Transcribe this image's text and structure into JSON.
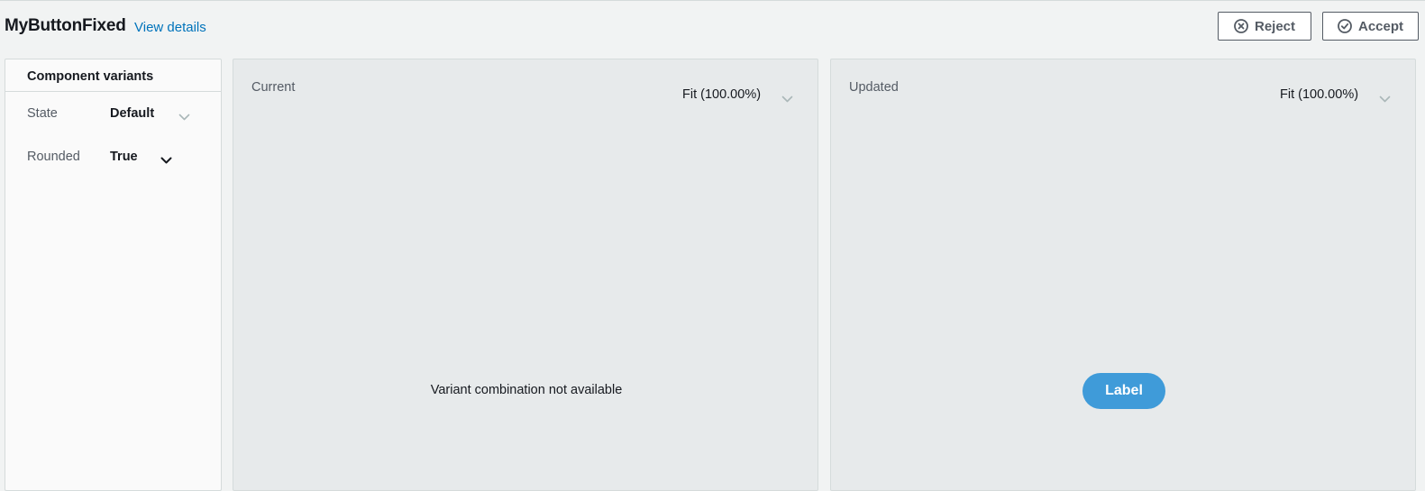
{
  "header": {
    "title": "MyButtonFixed",
    "view_details_link": "View details",
    "reject_label": "Reject",
    "accept_label": "Accept",
    "reject_icon": "circle-x-icon",
    "accept_icon": "circle-check-icon"
  },
  "sidebar": {
    "heading": "Component variants",
    "variants": [
      {
        "label": "State",
        "value": "Default"
      },
      {
        "label": "Rounded",
        "value": "True"
      }
    ]
  },
  "panels": {
    "current": {
      "label": "Current",
      "zoom": "Fit (100.00%)",
      "message": "Variant combination not available"
    },
    "updated": {
      "label": "Updated",
      "zoom": "Fit (100.00%)",
      "preview_button_label": "Label"
    }
  },
  "colors": {
    "link": "#0073bb",
    "preview_button": "#3f9bd9",
    "panel_bg": "#e7eaeb",
    "page_bg": "#f1f3f3"
  }
}
